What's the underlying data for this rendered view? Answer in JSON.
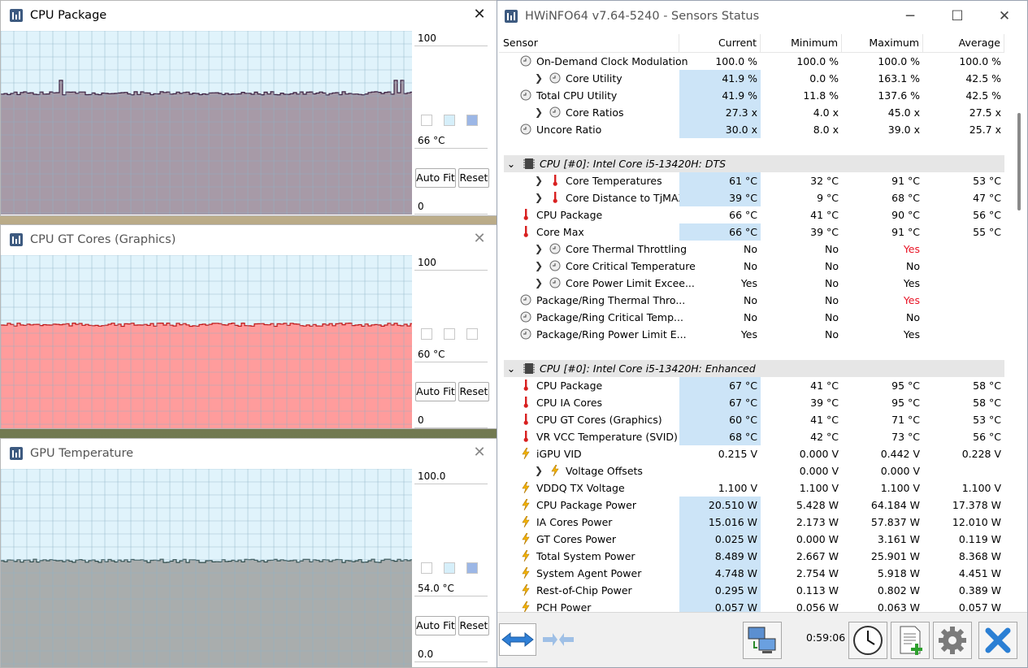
{
  "graphs": [
    {
      "title": "CPU Package",
      "max": "100",
      "current": "66 °C",
      "min": "0",
      "fill": "#a79aa7",
      "plot_bg": "#e0f3fb",
      "level": 0.66,
      "checks": [
        "#ffffff",
        "#d6effa",
        "#9cb7e6"
      ]
    },
    {
      "title": "CPU GT Cores (Graphics)",
      "max": "100",
      "current": "60 °C",
      "min": "0",
      "fill": "#ff9c9c",
      "plot_bg": "#e0f3fb",
      "level": 0.6,
      "checks": [
        "#ffffff",
        "#ffffff",
        "#ffffff"
      ]
    },
    {
      "title": "GPU Temperature",
      "max": "100.0",
      "current": "54.0 °C",
      "min": "0.0",
      "fill": "#a9adad",
      "plot_bg": "#e0f3fb",
      "level": 0.54,
      "checks": [
        "#ffffff",
        "#d6effa",
        "#9cb7e6"
      ]
    }
  ],
  "buttons": {
    "autofit": "Auto Fit",
    "reset": "Reset"
  },
  "main": {
    "title": "HWiNFO64 v7.64-5240 - Sensors Status",
    "columns": {
      "sensor": "Sensor",
      "current": "Current",
      "minimum": "Minimum",
      "maximum": "Maximum",
      "average": "Average"
    },
    "timer": "0:59:06"
  },
  "rows": [
    {
      "n": "On-Demand Clock Modulation",
      "i": "clock",
      "ind": 0,
      "exp": false,
      "c": "100.0 %",
      "mn": "100.0 %",
      "mx": "100.0 %",
      "av": "100.0 %",
      "hl": false
    },
    {
      "n": "Core Utility",
      "i": "clock",
      "ind": 1,
      "exp": true,
      "c": "41.9 %",
      "mn": "0.0 %",
      "mx": "163.1 %",
      "av": "42.5 %",
      "hl": true
    },
    {
      "n": "Total CPU Utility",
      "i": "clock",
      "ind": 0,
      "exp": false,
      "c": "41.9 %",
      "mn": "11.8 %",
      "mx": "137.6 %",
      "av": "42.5 %",
      "hl": true
    },
    {
      "n": "Core Ratios",
      "i": "clock",
      "ind": 1,
      "exp": true,
      "c": "27.3 x",
      "mn": "4.0 x",
      "mx": "45.0 x",
      "av": "27.5 x",
      "hl": true
    },
    {
      "n": "Uncore Ratio",
      "i": "clock",
      "ind": 0,
      "exp": false,
      "c": "30.0 x",
      "mn": "8.0 x",
      "mx": "39.0 x",
      "av": "25.7 x",
      "hl": true
    },
    {
      "blank": true
    },
    {
      "group": "CPU [#0]: Intel Core i5-13420H: DTS"
    },
    {
      "n": "Core Temperatures",
      "i": "therm",
      "ind": 1,
      "exp": true,
      "c": "61 °C",
      "mn": "32 °C",
      "mx": "91 °C",
      "av": "53 °C",
      "hl": true
    },
    {
      "n": "Core Distance to TjMAX",
      "i": "therm",
      "ind": 1,
      "exp": true,
      "c": "39 °C",
      "mn": "9 °C",
      "mx": "68 °C",
      "av": "47 °C",
      "hl": true
    },
    {
      "n": "CPU Package",
      "i": "therm",
      "ind": 0,
      "exp": false,
      "c": "66 °C",
      "mn": "41 °C",
      "mx": "90 °C",
      "av": "56 °C",
      "hl": false
    },
    {
      "n": "Core Max",
      "i": "therm",
      "ind": 0,
      "exp": false,
      "c": "66 °C",
      "mn": "39 °C",
      "mx": "91 °C",
      "av": "55 °C",
      "hl": true
    },
    {
      "n": "Core Thermal Throttling",
      "i": "clock",
      "ind": 1,
      "exp": true,
      "c": "No",
      "mn": "No",
      "mx": "Yes",
      "av": "",
      "hl": false,
      "mxred": true
    },
    {
      "n": "Core Critical Temperature",
      "i": "clock",
      "ind": 1,
      "exp": true,
      "c": "No",
      "mn": "No",
      "mx": "No",
      "av": "",
      "hl": false
    },
    {
      "n": "Core Power Limit Excee...",
      "i": "clock",
      "ind": 1,
      "exp": true,
      "c": "Yes",
      "mn": "No",
      "mx": "Yes",
      "av": "",
      "hl": false
    },
    {
      "n": "Package/Ring Thermal Thro...",
      "i": "clock",
      "ind": 0,
      "exp": false,
      "c": "No",
      "mn": "No",
      "mx": "Yes",
      "av": "",
      "hl": false,
      "mxred": true
    },
    {
      "n": "Package/Ring Critical Temp...",
      "i": "clock",
      "ind": 0,
      "exp": false,
      "c": "No",
      "mn": "No",
      "mx": "No",
      "av": "",
      "hl": false
    },
    {
      "n": "Package/Ring Power Limit E...",
      "i": "clock",
      "ind": 0,
      "exp": false,
      "c": "Yes",
      "mn": "No",
      "mx": "Yes",
      "av": "",
      "hl": false
    },
    {
      "blank": true
    },
    {
      "group": "CPU [#0]: Intel Core i5-13420H: Enhanced"
    },
    {
      "n": "CPU Package",
      "i": "therm",
      "ind": 0,
      "exp": false,
      "c": "67 °C",
      "mn": "41 °C",
      "mx": "95 °C",
      "av": "58 °C",
      "hl": true
    },
    {
      "n": "CPU IA Cores",
      "i": "therm",
      "ind": 0,
      "exp": false,
      "c": "67 °C",
      "mn": "39 °C",
      "mx": "95 °C",
      "av": "58 °C",
      "hl": true
    },
    {
      "n": "CPU GT Cores (Graphics)",
      "i": "therm",
      "ind": 0,
      "exp": false,
      "c": "60 °C",
      "mn": "41 °C",
      "mx": "71 °C",
      "av": "53 °C",
      "hl": true
    },
    {
      "n": "VR VCC Temperature (SVID)",
      "i": "therm",
      "ind": 0,
      "exp": false,
      "c": "68 °C",
      "mn": "42 °C",
      "mx": "73 °C",
      "av": "56 °C",
      "hl": true
    },
    {
      "n": "iGPU VID",
      "i": "bolt",
      "ind": 0,
      "exp": false,
      "c": "0.215 V",
      "mn": "0.000 V",
      "mx": "0.442 V",
      "av": "0.228 V",
      "hl": false
    },
    {
      "n": "Voltage Offsets",
      "i": "bolt",
      "ind": 1,
      "exp": true,
      "c": "",
      "mn": "0.000 V",
      "mx": "0.000 V",
      "av": "",
      "hl": false
    },
    {
      "n": "VDDQ TX Voltage",
      "i": "bolt",
      "ind": 0,
      "exp": false,
      "c": "1.100 V",
      "mn": "1.100 V",
      "mx": "1.100 V",
      "av": "1.100 V",
      "hl": false
    },
    {
      "n": "CPU Package Power",
      "i": "bolt",
      "ind": 0,
      "exp": false,
      "c": "20.510 W",
      "mn": "5.428 W",
      "mx": "64.184 W",
      "av": "17.378 W",
      "hl": true
    },
    {
      "n": "IA Cores Power",
      "i": "bolt",
      "ind": 0,
      "exp": false,
      "c": "15.016 W",
      "mn": "2.173 W",
      "mx": "57.837 W",
      "av": "12.010 W",
      "hl": true
    },
    {
      "n": "GT Cores Power",
      "i": "bolt",
      "ind": 0,
      "exp": false,
      "c": "0.025 W",
      "mn": "0.000 W",
      "mx": "3.161 W",
      "av": "0.119 W",
      "hl": true
    },
    {
      "n": "Total System Power",
      "i": "bolt",
      "ind": 0,
      "exp": false,
      "c": "8.489 W",
      "mn": "2.667 W",
      "mx": "25.901 W",
      "av": "8.368 W",
      "hl": true
    },
    {
      "n": "System Agent Power",
      "i": "bolt",
      "ind": 0,
      "exp": false,
      "c": "4.748 W",
      "mn": "2.754 W",
      "mx": "5.918 W",
      "av": "4.451 W",
      "hl": true
    },
    {
      "n": "Rest-of-Chip Power",
      "i": "bolt",
      "ind": 0,
      "exp": false,
      "c": "0.295 W",
      "mn": "0.113 W",
      "mx": "0.802 W",
      "av": "0.389 W",
      "hl": true
    },
    {
      "n": "PCH Power",
      "i": "bolt",
      "ind": 0,
      "exp": false,
      "c": "0.057 W",
      "mn": "0.056 W",
      "mx": "0.063 W",
      "av": "0.057 W",
      "hl": true
    }
  ]
}
